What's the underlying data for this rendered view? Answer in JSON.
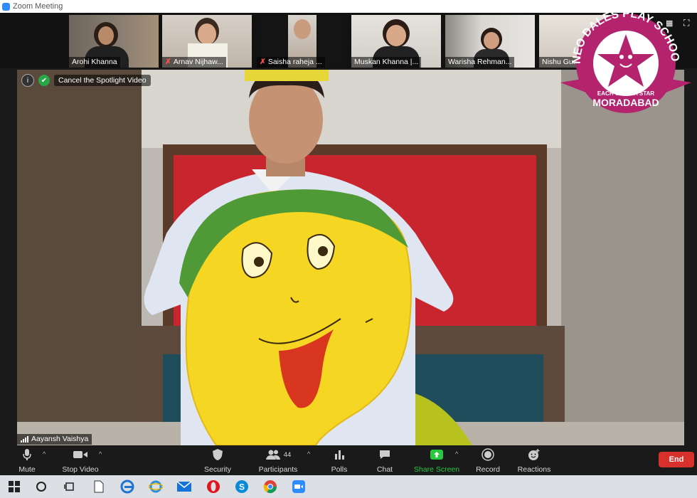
{
  "window": {
    "title": "Zoom Meeting"
  },
  "participants": [
    {
      "name": "Arohi Khanna",
      "muted": false
    },
    {
      "name": "Arnav Nijhaw...",
      "muted": true
    },
    {
      "name": "Saisha raheja ...",
      "muted": true
    },
    {
      "name": "Muskan Khanna |...",
      "muted": false
    },
    {
      "name": "Warisha Rehman...",
      "muted": false
    },
    {
      "name": "Nishu Gu...",
      "muted": false
    }
  ],
  "spotlight": {
    "cancel_label": "Cancel the Spotlight Video"
  },
  "active_speaker": {
    "name": "Aayansh Vaishya"
  },
  "logo": {
    "top_text": "NEO DALES PLAY SCHOOL",
    "ribbon_text": "EACH CHILD A STAR",
    "bottom_text": "MORADABAD"
  },
  "toolbar": {
    "mute": "Mute",
    "stop_video": "Stop Video",
    "security": "Security",
    "participants": "Participants",
    "participant_count": "44",
    "polls": "Polls",
    "chat": "Chat",
    "share_screen": "Share Screen",
    "record": "Record",
    "reactions": "Reactions",
    "end": "End"
  },
  "colors": {
    "share_green": "#27c93f",
    "end_red": "#d8302a",
    "logo_magenta": "#b3236e",
    "zoom_blue": "#2d8cff"
  },
  "taskbar_icons": [
    "windows-start-icon",
    "search-circle-icon",
    "task-view-icon",
    "file-icon",
    "edge-icon",
    "internet-explorer-icon",
    "mail-icon",
    "opera-icon",
    "skype-icon",
    "chrome-icon",
    "zoom-icon"
  ]
}
